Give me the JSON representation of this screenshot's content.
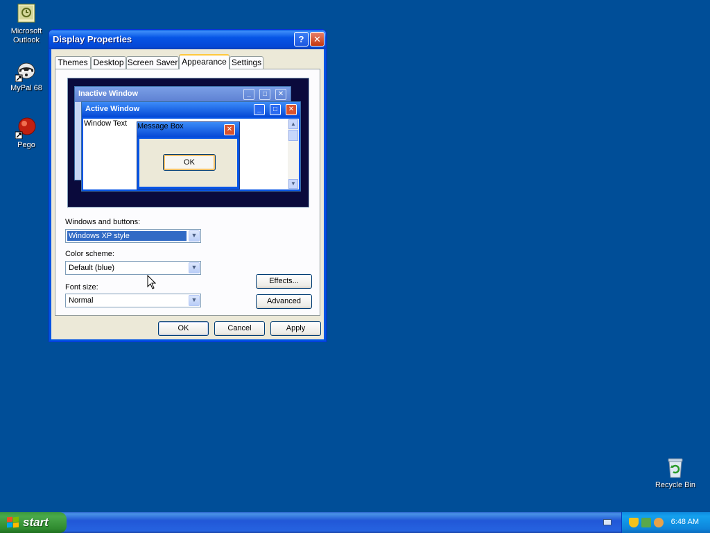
{
  "desktop": {
    "icons": [
      {
        "label_line1": "Microsoft",
        "label_line2": "Outlook"
      },
      {
        "label_line1": "MyPal 68",
        "label_line2": ""
      },
      {
        "label_line1": "Pego",
        "label_line2": ""
      },
      {
        "label_line1": "Recycle Bin",
        "label_line2": ""
      }
    ]
  },
  "window": {
    "title": "Display Properties",
    "help_label": "?",
    "close_label": "✕",
    "tabs": [
      {
        "label": "Themes",
        "active": false
      },
      {
        "label": "Desktop",
        "active": false
      },
      {
        "label": "Screen Saver",
        "active": false
      },
      {
        "label": "Appearance",
        "active": true
      },
      {
        "label": "Settings",
        "active": false
      }
    ],
    "preview": {
      "inactive_title": "Inactive Window",
      "active_title": "Active Window",
      "window_text": "Window Text",
      "msgbox_title": "Message Box",
      "msgbox_ok": "OK"
    },
    "windows_buttons": {
      "label": "Windows and buttons:",
      "value": "Windows XP style"
    },
    "color_scheme": {
      "label": "Color scheme:",
      "value": "Default (blue)"
    },
    "font_size": {
      "label": "Font size:",
      "value": "Normal"
    },
    "effects_label": "Effects...",
    "advanced_label": "Advanced",
    "ok_label": "OK",
    "cancel_label": "Cancel",
    "apply_label": "Apply"
  },
  "taskbar": {
    "start_label": "start",
    "clock": "6:48 AM"
  },
  "colors": {
    "desktop": "#004e98",
    "titlebar": "#0447d5",
    "start": "#3c9a3c",
    "tray": "#0e84da",
    "active_tab_accent": "#ffc83c"
  }
}
